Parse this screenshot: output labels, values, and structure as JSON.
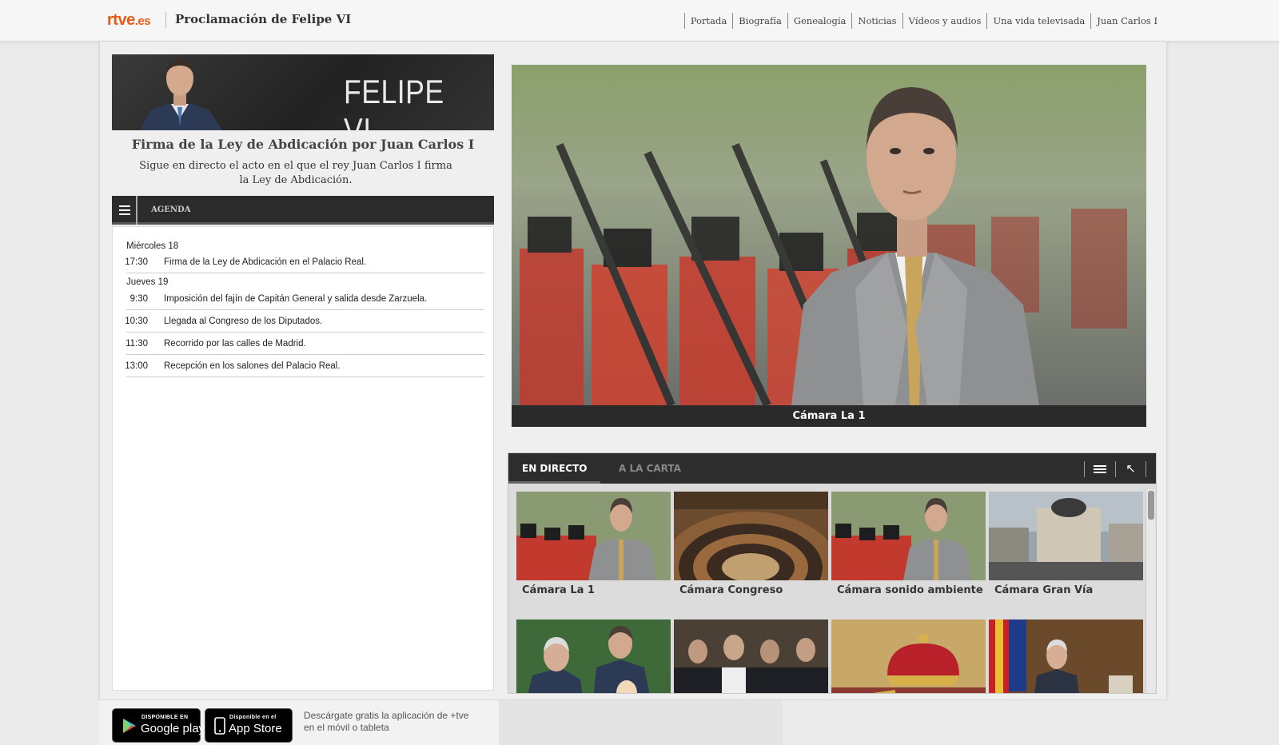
{
  "header": {
    "logo_main": "rtve",
    "logo_suffix": ".es",
    "site_title": "Proclamación de Felipe VI",
    "nav": [
      "Portada",
      "Biografía",
      "Genealogía",
      "Noticias",
      "Vídeos y audios",
      "Una vida televisada",
      "Juan Carlos I"
    ]
  },
  "banner": {
    "title": "FELIPE VI"
  },
  "event": {
    "title": "Firma de la Ley de Abdicación por Juan Carlos I",
    "desc_line1": "Sigue en directo el acto en el que el rey Juan Carlos I firma",
    "desc_line2": "la Ley de Abdicación."
  },
  "agenda": {
    "label": "AGENDA",
    "days": [
      {
        "name": "Miércoles 18",
        "items": [
          {
            "time": "17:30",
            "text": "Firma de la Ley de Abdicación en el Palacio Real."
          }
        ]
      },
      {
        "name": "Jueves 19",
        "items": [
          {
            "time": "9:30",
            "text": "Imposición del fajín de Capitán General y salida desde Zarzuela."
          },
          {
            "time": "10:30",
            "text": "Llegada al Congreso de los Diputados."
          },
          {
            "time": "11:30",
            "text": "Recorrido por las calles de Madrid."
          },
          {
            "time": "13:00",
            "text": "Recepción en los salones del Palacio Real."
          }
        ]
      }
    ]
  },
  "player": {
    "caption": "Cámara La 1"
  },
  "channels": {
    "tabs": [
      "EN DIRECTO",
      "A LA CARTA"
    ],
    "row1": [
      "Cámara La 1",
      "Cámara Congreso",
      "Cámara sonido ambiente",
      "Cámara Gran Vía"
    ]
  },
  "footer": {
    "google_small": "DISPONIBLE EN",
    "google_big": "Google play",
    "apple_small": "Disponible en el",
    "apple_big": "App Store",
    "promo_line1": "Descárgate gratis la aplicación de +tve",
    "promo_line2": "en el móvil o tableta"
  },
  "colors": {
    "brand": "#e65c17",
    "dark_bar": "#2b2b2b"
  }
}
